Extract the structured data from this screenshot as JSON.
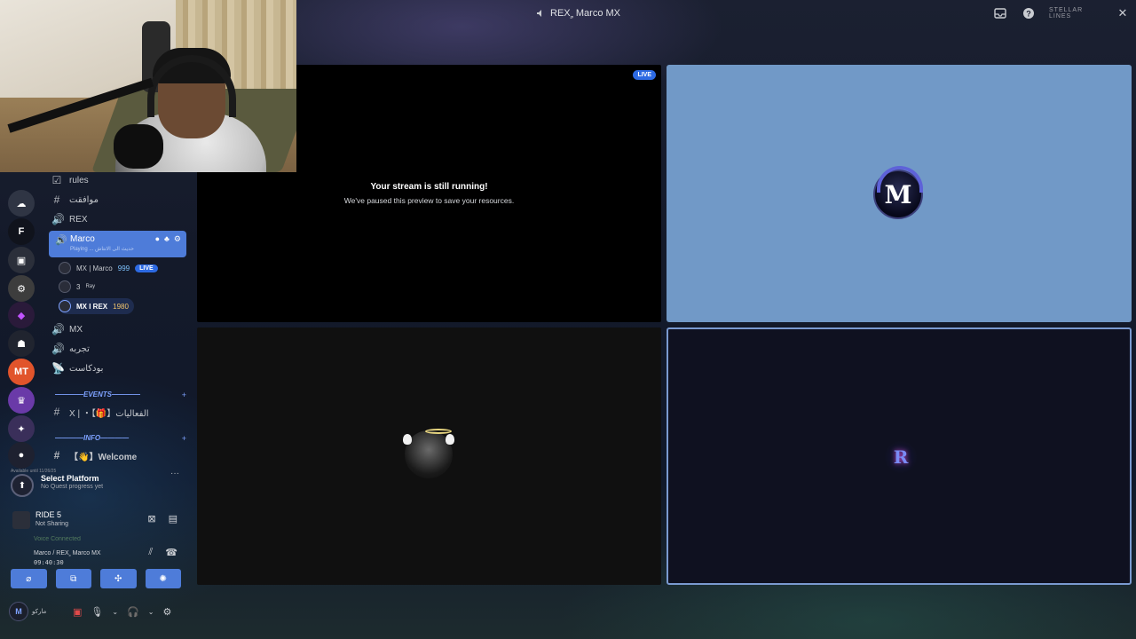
{
  "window": {
    "title": "REX ٍ Marco MX",
    "watermark": "STELLAR LINES"
  },
  "channels": {
    "items": [
      {
        "glyph": "☑",
        "label": "rules"
      },
      {
        "glyph": "#",
        "label": "موافقت"
      },
      {
        "glyph": "🔊",
        "label": "REX"
      }
    ],
    "active": {
      "label": "Marco",
      "subtitle": "Playing ... حديث الى الانتاش"
    },
    "members": [
      {
        "label": "MX | Marco",
        "badge": "999",
        "live": "LIVE"
      },
      {
        "label": "3",
        "badge": "Ray"
      },
      {
        "label": "MX I REX",
        "badge": "1980"
      }
    ],
    "more": [
      {
        "glyph": "🔊",
        "label": "MX"
      },
      {
        "glyph": "🔊",
        "label": "تجربه"
      },
      {
        "glyph": "📡",
        "label": "بودكاست"
      }
    ],
    "category_events": "————EVENTS————",
    "event_channel": "X | ・【🎁】الفعاليات",
    "category_info": "————INFO————",
    "info_channel": "【👋】Welcome"
  },
  "quest": {
    "small": "Available until 11/26/25",
    "title": "Select Platform",
    "subtitle": "No Quest progress yet"
  },
  "activity": {
    "title": "RIDE 5",
    "subtitle": "Not Sharing"
  },
  "voice": {
    "blur": "Voice Connected",
    "channel": "Marco / REX ٍ Marco MX",
    "time": "09:40:30"
  },
  "user": {
    "name": "ماركو"
  },
  "tiles": {
    "paused_title": "Your stream is still running!",
    "paused_sub": "We've paused this preview to save your resources.",
    "live": "LIVE",
    "logo_m": "M",
    "logo_r": "R"
  }
}
